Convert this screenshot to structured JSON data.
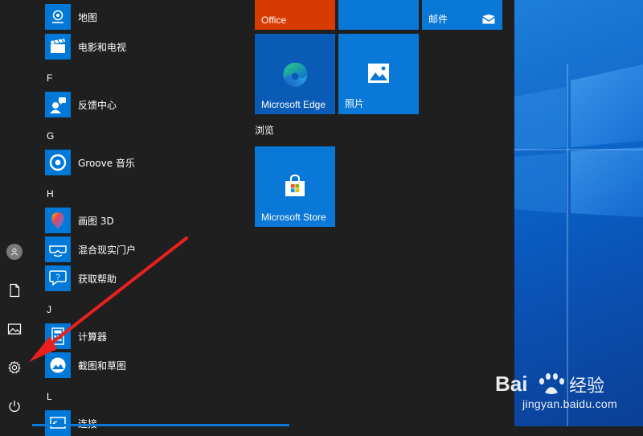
{
  "start_menu": {
    "rail": {
      "items": [
        {
          "name": "user-account",
          "icon": "user-icon"
        },
        {
          "name": "documents",
          "icon": "document-icon"
        },
        {
          "name": "pictures",
          "icon": "pictures-icon"
        },
        {
          "name": "settings",
          "icon": "gear-icon"
        },
        {
          "name": "power",
          "icon": "power-icon"
        }
      ]
    },
    "app_list": {
      "letters": {
        "F": "F",
        "G": "G",
        "H": "H",
        "J": "J",
        "L": "L"
      },
      "apps": {
        "maps": "地图",
        "movies_tv": "电影和电视",
        "feedback_hub": "反馈中心",
        "groove_music": "Groove 音乐",
        "paint_3d": "画图 3D",
        "mixed_reality": "混合现实门户",
        "get_help": "获取帮助",
        "calculator": "计算器",
        "snip_sketch": "截图和草图",
        "connect": "连接"
      }
    },
    "tiles": {
      "office": "Office",
      "mail": "邮件",
      "edge": "Microsoft Edge",
      "photos": "照片",
      "browse_group": "浏览",
      "store": "Microsoft Store"
    }
  },
  "colors": {
    "accent": "#0078d7",
    "office": "#d83b01",
    "menu_bg": "#1f1f1f",
    "arrow": "#e8211f"
  },
  "watermark": {
    "brand": "Bai 经验",
    "url": "jingyan.baidu.com"
  }
}
